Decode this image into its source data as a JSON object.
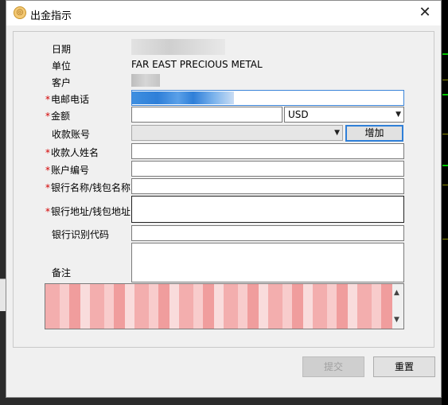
{
  "window": {
    "title": "出金指示",
    "close_glyph": "✕"
  },
  "form": {
    "date_label": "日期",
    "unit_label": "单位",
    "unit_value": "FAR EAST PRECIOUS METAL",
    "customer_label": "客户",
    "phone_label": "电邮电话",
    "phone_value_suffix": ".co",
    "amount_label": "金额",
    "amount_value": "",
    "currency_value": "USD",
    "account_label": "收款账号",
    "add_button": "增加",
    "payee_name_label": "收款人姓名",
    "account_no_label": "账户编号",
    "bank_name_label": "银行名称/钱包名称",
    "bank_address_label": "银行地址/钱包地址",
    "bank_code_label": "银行识别代码",
    "remarks_label": "备注",
    "required_mark": "*"
  },
  "buttons": {
    "submit": "提交",
    "reset": "重置"
  },
  "colors": {
    "required": "#d40000",
    "focus_border": "#2f7fd8",
    "notice_text": "#e05050"
  }
}
